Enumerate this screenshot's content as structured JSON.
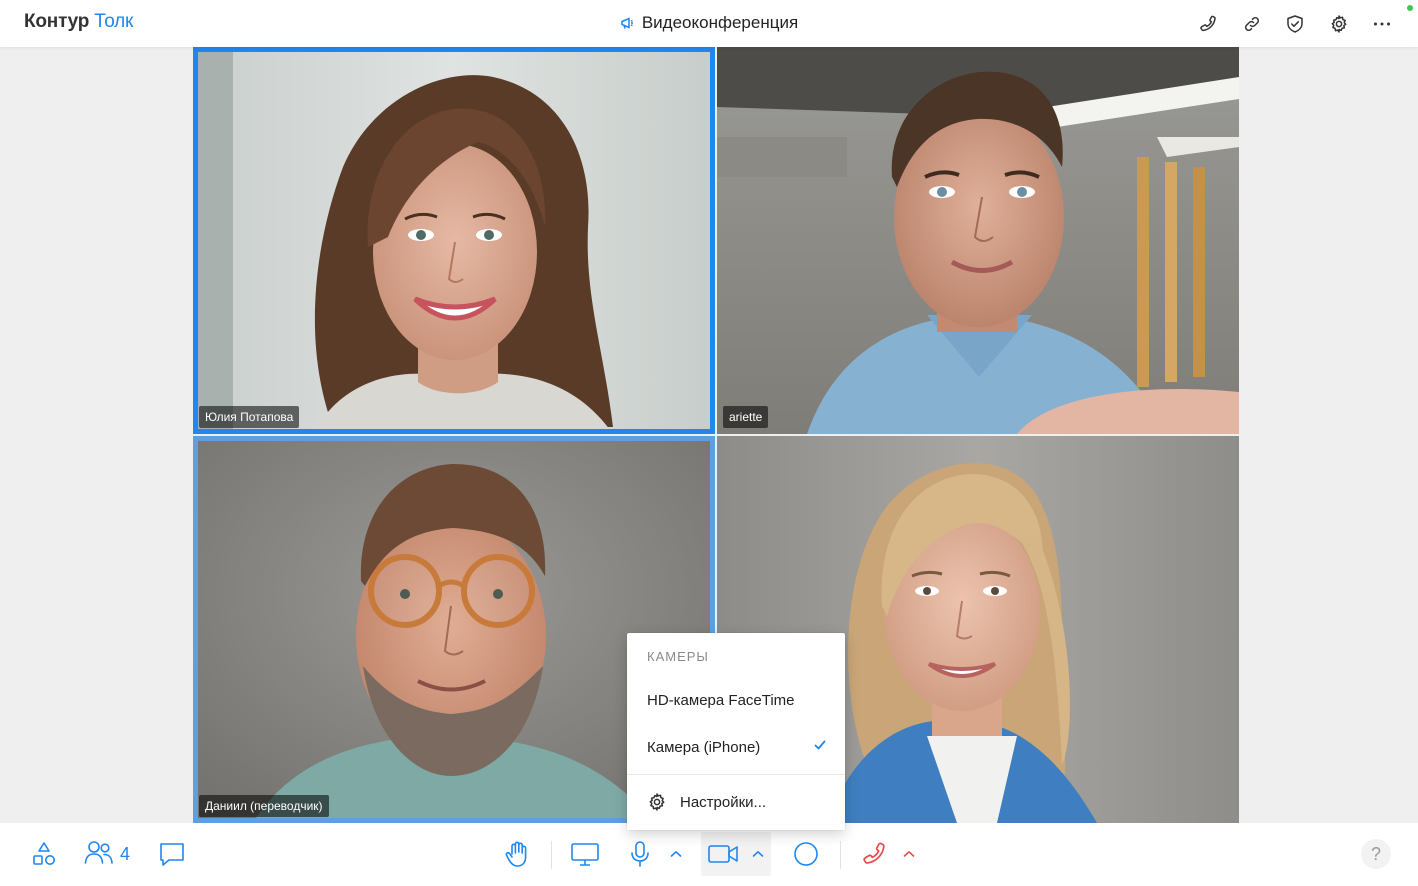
{
  "header": {
    "logo_brand": "Контур",
    "logo_product": "Толк",
    "title": "Видеоконференция",
    "actions": [
      "phone-icon",
      "link-icon",
      "shield-check-icon",
      "gear-icon",
      "more-icon"
    ]
  },
  "participants": [
    {
      "name": "Юлия Потапова",
      "active_speaker": true
    },
    {
      "name": "ariette",
      "active_speaker": false
    },
    {
      "name": "Даниил (переводчик)",
      "active_speaker": false
    },
    {
      "name": "",
      "active_speaker": false
    }
  ],
  "camera_menu": {
    "header": "КАМЕРЫ",
    "options": [
      {
        "label": "HD-камера FaceTime",
        "selected": false
      },
      {
        "label": "Камера (iPhone)",
        "selected": true
      }
    ],
    "settings_label": "Настройки..."
  },
  "toolbar": {
    "participants_count": "4",
    "help_label": "?",
    "buttons": [
      "shapes-icon",
      "participants-icon",
      "chat-icon",
      "raise-hand-icon",
      "screen-share-icon",
      "microphone-icon",
      "camera-icon",
      "record-icon",
      "hangup-icon",
      "help-icon"
    ]
  },
  "colors": {
    "accent": "#1f87ef",
    "hangup": "#e8484a",
    "status_online": "#3cc853"
  }
}
